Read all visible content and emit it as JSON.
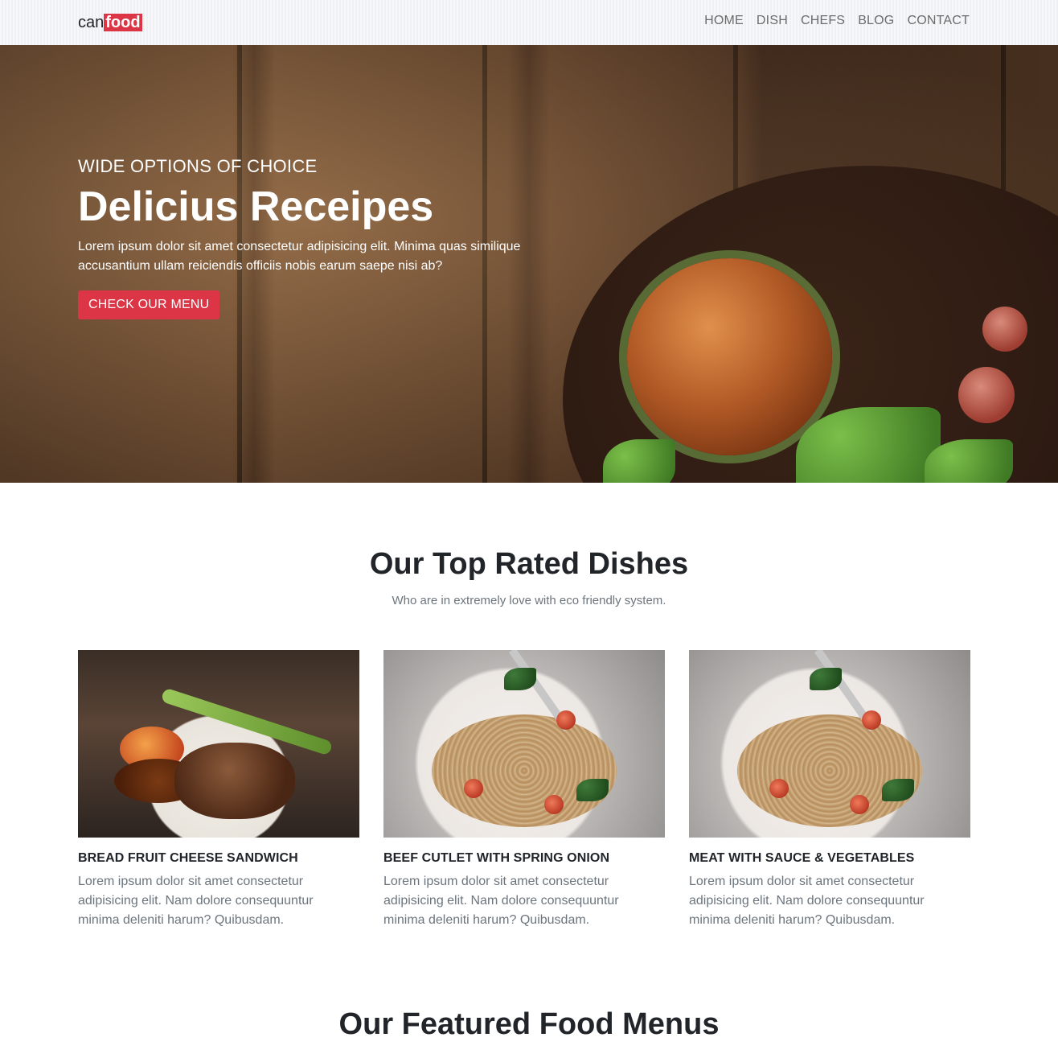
{
  "navbar": {
    "brand_prefix": "can",
    "brand_highlight": "food",
    "links": [
      "HOME",
      "DISH",
      "CHEFS",
      "BLOG",
      "CONTACT"
    ]
  },
  "hero": {
    "subtitle": "WIDE OPTIONS OF CHOICE",
    "title": "Delicius Receipes",
    "text": "Lorem ipsum dolor sit amet consectetur adipisicing elit. Minima quas similique accusantium ullam reiciendis officiis nobis earum saepe nisi ab?",
    "button": "CHECK OUR MENU"
  },
  "top_rated": {
    "title": "Our Top Rated Dishes",
    "subtitle": "Who are in extremely love with eco friendly system.",
    "cards": [
      {
        "title": "BREAD FRUIT CHEESE SANDWICH",
        "text": "Lorem ipsum dolor sit amet consectetur adipisicing elit. Nam dolore consequuntur minima deleniti harum? Quibusdam."
      },
      {
        "title": "BEEF CUTLET WITH SPRING ONION",
        "text": "Lorem ipsum dolor sit amet consectetur adipisicing elit. Nam dolore consequuntur minima deleniti harum? Quibusdam."
      },
      {
        "title": "MEAT WITH SAUCE & VEGETABLES",
        "text": "Lorem ipsum dolor sit amet consectetur adipisicing elit. Nam dolore consequuntur minima deleniti harum? Quibusdam."
      }
    ]
  },
  "featured": {
    "title": "Our Featured Food Menus"
  },
  "colors": {
    "accent": "#dc3545",
    "heading": "#212529",
    "muted": "#6c757d"
  }
}
